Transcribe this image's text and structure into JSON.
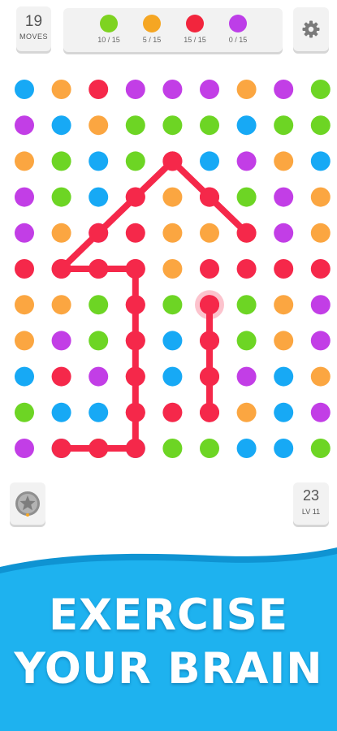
{
  "hud": {
    "moves": {
      "value": "19",
      "label": "MOVES"
    },
    "goals": [
      {
        "color": "#7ed321",
        "progress": "10 / 15"
      },
      {
        "color": "#f5a623",
        "progress": "5 / 15"
      },
      {
        "color": "#f2253d",
        "progress": "15 / 15"
      },
      {
        "color": "#bd3ee8",
        "progress": "0 / 15"
      }
    ],
    "settings_icon": "gear-icon"
  },
  "bottom": {
    "powerup_icon": "star-icon",
    "level": {
      "value": "23",
      "label": "LV 11"
    }
  },
  "board": {
    "palette": {
      "b": "#17a9f5",
      "o": "#fba641",
      "r": "#f5284a",
      "p": "#c23ee6",
      "g": "#6dd524"
    },
    "rows": [
      "borpppopg",
      "pbogggbgg",
      "ogbgrbpob",
      "pgbrorgpo",
      "poprooopo",
      "rrrrorrrr",
      "oogrgrgop",
      "opgrbrgop",
      "brprbrpbo",
      "gbbrrrobp",
      "pbgbggbbg"
    ],
    "path_color": "#f5284a",
    "path": [
      [
        10,
        1
      ],
      [
        10,
        2
      ],
      [
        10,
        3
      ],
      [
        9,
        3
      ],
      [
        8,
        3
      ],
      [
        7,
        3
      ],
      [
        6,
        3
      ],
      [
        5,
        3
      ],
      [
        5,
        2
      ],
      [
        5,
        1
      ],
      [
        4,
        2
      ],
      [
        3,
        3
      ],
      [
        2,
        4
      ],
      [
        3,
        5
      ],
      [
        4,
        6
      ]
    ],
    "path_start": [
      6,
      5
    ],
    "path_start_from": [
      9,
      5
    ]
  },
  "banner": {
    "line1": "EXERCISE",
    "line2": "YOUR BRAIN",
    "color": "#1eb2ef"
  }
}
